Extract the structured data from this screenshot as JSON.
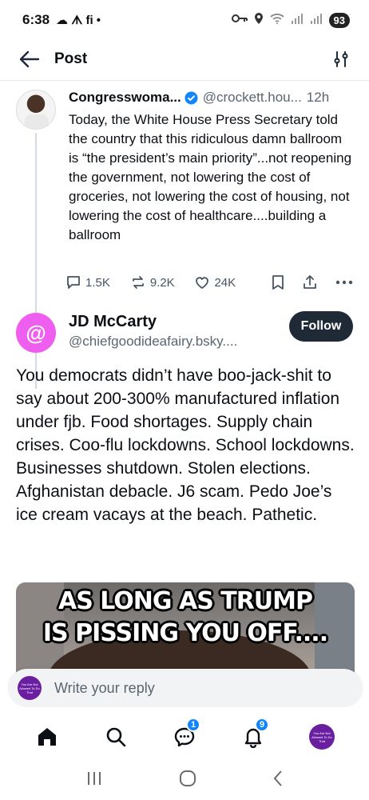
{
  "status_bar": {
    "time": "6:38",
    "left_glyphs": "☁ ᗑ fi •",
    "battery": "93"
  },
  "header": {
    "title": "Post"
  },
  "parent_post": {
    "display_name": "Congresswoma...",
    "handle": "@crockett.hou...",
    "time": "12h",
    "text": "Today, the White House Press Secretary told the country that this ridiculous damn ballroom is “the president’s main priority”...not reopening the government, not lowering the cost of groceries, not lowering the cost of housing, not lowering the cost of healthcare....building a ballroom",
    "replies": "1.5K",
    "reposts": "9.2K",
    "likes": "24K"
  },
  "reply_post": {
    "display_name": "JD McCarty",
    "handle": "@chiefgoodideafairy.bsky....",
    "avatar_glyph": "@",
    "avatar_color": "#ee5eef",
    "follow_label": "Follow",
    "text": "You democrats didn’t have boo-jack-shit to say about 200-300% manufactured inflation under fjb. Food shortages. Supply chain crises. Coo-flu lockdowns. School lockdowns. Businesses shutdown. Stolen elections. Afghanistan debacle. J6 scam. Pedo Joe’s ice cream vacays at the beach. Pathetic.",
    "image_caption_line1": "AS LONG AS TRUMP",
    "image_caption_line2": "IS PISSING YOU OFF...."
  },
  "composer": {
    "placeholder": "Write your reply",
    "avatar_text": "You Are Not Allowed To Do That"
  },
  "tabbar": {
    "chat_badge": "1",
    "notifications_badge": "9",
    "me_avatar_text": "You Are Not Allowed To Do That"
  },
  "colors": {
    "accent": "#1185fe",
    "follow_button": "#1f2a36",
    "reply_avatar": "#ee5eef"
  }
}
